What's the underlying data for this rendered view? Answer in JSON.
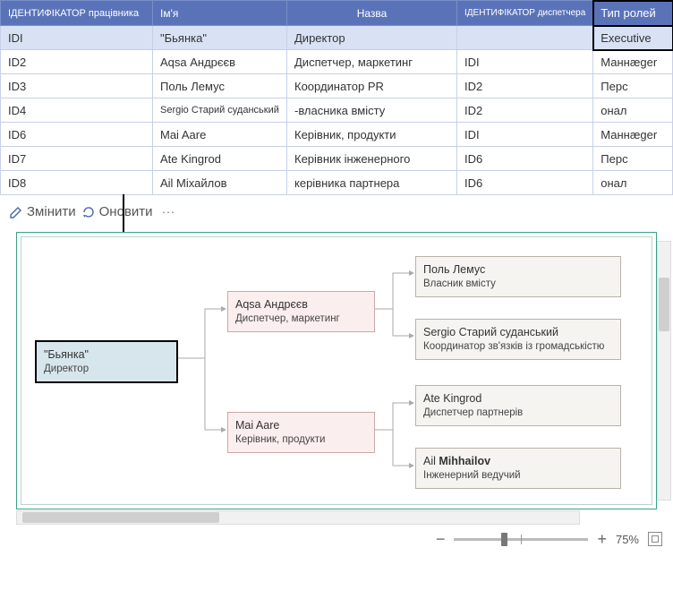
{
  "table": {
    "headers": [
      "ІДЕНТИФІКАТОР працівника",
      "Ім'я",
      "Назва",
      "ІДЕНТИФІКАТОР диспетчера",
      "Тип ролей"
    ],
    "rows": [
      {
        "id": "IDI",
        "name": "\"Бьянка\"",
        "title": "Директор",
        "mgr": "",
        "role": "Executive"
      },
      {
        "id": "ID2",
        "name": "Aqsa Андрєєв",
        "title": "Диспетчер, маркетинг",
        "mgr": "IDI",
        "role": "Маннæger"
      },
      {
        "id": "ID3",
        "name": "Поль Лемус",
        "title": "Координатор PR",
        "mgr": "ID2",
        "role": "Перс"
      },
      {
        "id": "ID4",
        "name": "Sergio Старий суданський",
        "title": "-власника вмісту",
        "mgr": "ID2",
        "role": "онал"
      },
      {
        "id": "ID6",
        "name": "Mai Aare",
        "title": "Керівник, продукти",
        "mgr": "IDI",
        "role": "Маннæger"
      },
      {
        "id": "ID7",
        "name": "Ate Kingrod",
        "title": "Керівник інженерного",
        "mgr": "ID6",
        "role": "Перс"
      },
      {
        "id": "ID8",
        "name": "Ail Міхайлов",
        "title": "керівника партнера",
        "mgr": "ID6",
        "role": "онал"
      }
    ]
  },
  "toolbar": {
    "edit": "Змінити",
    "refresh": "Оновити"
  },
  "diagram": {
    "root": {
      "name": "\"Бьянка\"",
      "title": "Директор"
    },
    "c1": {
      "name": "Aqsa Андрєєв",
      "title": "Диспетчер, маркетинг"
    },
    "c2": {
      "name": "Mai Aare",
      "title": "Керівник, продукти"
    },
    "g1": {
      "name": "Поль Лемус",
      "title": "Власник вмісту"
    },
    "g2": {
      "name": "Sergio Старий суданський",
      "title": "Координатор зв'язків із громадськістю"
    },
    "g3": {
      "name": "Ate Kingrod",
      "title": "Диспетчер партнерів"
    },
    "g4a": "Ail",
    "g4b": "Mihhailov",
    "g4t": "Інженерний ведучий"
  },
  "zoom": {
    "value": "75%"
  }
}
